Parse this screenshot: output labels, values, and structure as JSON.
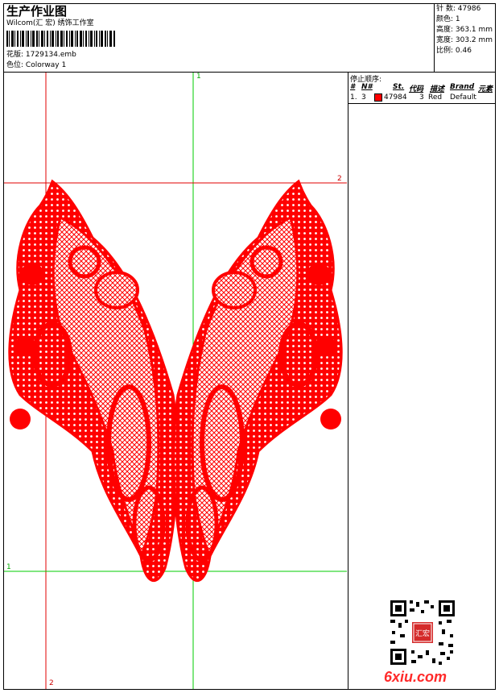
{
  "header": {
    "title": "生产作业图",
    "company": "Wilcom(汇 宏) 绣饰工作室",
    "design_label": "花版:",
    "design_value": "1729134.emb",
    "colorway_label": "色位:",
    "colorway_value": "Colorway 1"
  },
  "stats": {
    "stitches": "针 数: 47986",
    "colors": "颜色: 1",
    "height": "高度: 363.1 mm",
    "width": "宽度: 303.2 mm",
    "scale": "比例: 0.46"
  },
  "stop_sequence": {
    "title": "停止顺序:",
    "headers": [
      "#",
      "N#",
      "St.",
      "代码",
      "描述",
      "Brand",
      "元素"
    ],
    "rows": [
      {
        "index": "1.",
        "needle": "3",
        "stitches": "47984",
        "code": "3",
        "description": "Red",
        "brand": "Default"
      }
    ]
  },
  "colors": {
    "thread": "#ff0000",
    "guide_green": "#00cc00",
    "guide_red": "#e00000"
  },
  "guides": {
    "v_green_label": "1",
    "h_red_label": "2",
    "h_green_label": "1",
    "v_red_label": "2"
  },
  "watermark": "6xiu.com",
  "qr_seal": "汇宏"
}
